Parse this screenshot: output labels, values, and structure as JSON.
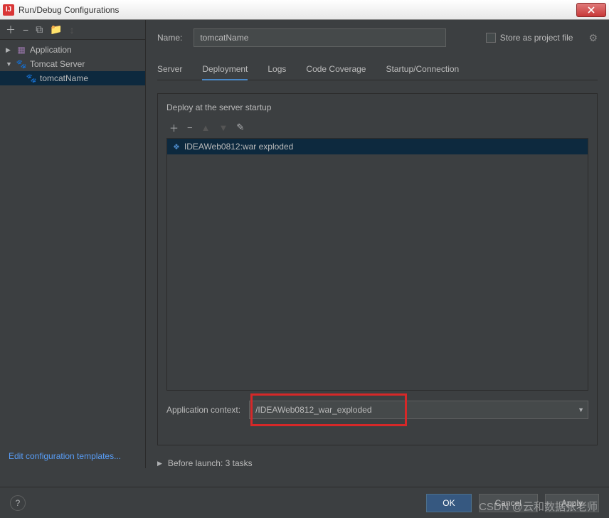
{
  "window": {
    "title": "Run/Debug Configurations"
  },
  "sidebar": {
    "application_label": "Application",
    "tomcat_label": "Tomcat Server",
    "config_name": "tomcatName",
    "edit_templates": "Edit configuration templates..."
  },
  "form": {
    "name_label": "Name:",
    "name_value": "tomcatName",
    "store_label": "Store as project file"
  },
  "tabs": {
    "server": "Server",
    "deployment": "Deployment",
    "logs": "Logs",
    "coverage": "Code Coverage",
    "startup": "Startup/Connection"
  },
  "deploy": {
    "heading": "Deploy at the server startup",
    "artifact": "IDEAWeb0812:war exploded",
    "context_label": "Application context:",
    "context_value": "/IDEAWeb0812_war_exploded"
  },
  "before_launch": "Before launch: 3 tasks",
  "buttons": {
    "ok": "OK",
    "cancel": "Cancel",
    "apply": "Apply"
  },
  "watermark": "CSDN @云和数据张老师"
}
